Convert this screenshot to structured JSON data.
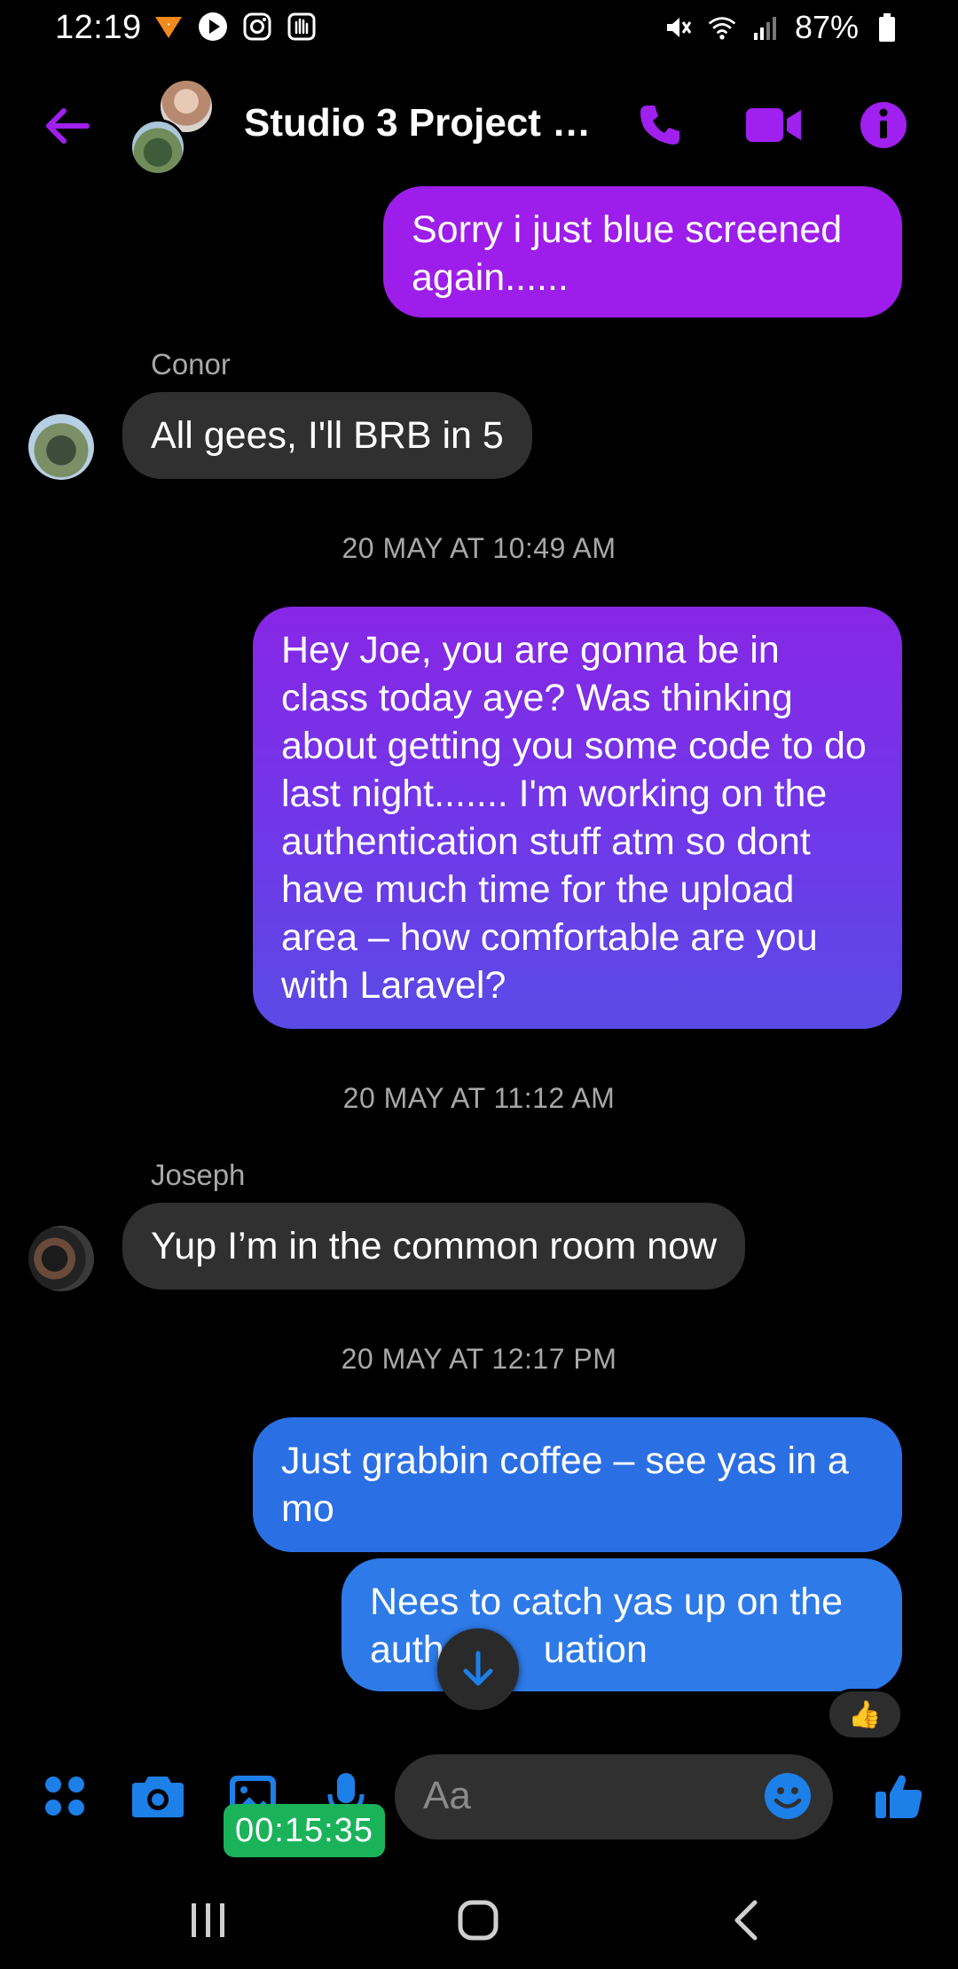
{
  "status_bar": {
    "time": "12:19",
    "battery": "87%",
    "icons": [
      "app-notification-icon",
      "play-icon",
      "instagram-icon",
      "hand-icon",
      "mute-icon",
      "wifi-icon",
      "signal-icon",
      "battery-icon"
    ]
  },
  "header": {
    "title": "Studio 3 Project T...",
    "buttons": [
      "back-arrow-icon",
      "phone-icon",
      "video-icon",
      "info-icon"
    ],
    "accent_color": "#a020f0"
  },
  "messages": [
    {
      "type": "sent",
      "text": "Sorry i just blue screened again......"
    },
    {
      "type": "received",
      "sender": "Conor",
      "text": "All gees, I'll BRB in 5"
    },
    {
      "type": "timestamp",
      "text": "20 MAY AT 10:49 AM"
    },
    {
      "type": "sent",
      "text": "Hey Joe, you are gonna be in class today aye? Was thinking about getting you some code to do last night....... I'm working on the authentication stuff atm so dont have much time for the upload area – how comfortable are you with Laravel?"
    },
    {
      "type": "timestamp",
      "text": "20 MAY AT 11:12 AM"
    },
    {
      "type": "received",
      "sender": "Joseph",
      "text": "Yup I’m in the common room now"
    },
    {
      "type": "timestamp",
      "text": "20 MAY AT 12:17 PM"
    },
    {
      "type": "sent",
      "text": "Just grabbin coffee – see yas in a mo"
    },
    {
      "type": "sent",
      "text": "Nees to catch yas up on the authentication"
    }
  ],
  "last_message_visible": [
    "Nees to catch yas up on the",
    "auth",
    "uation"
  ],
  "reaction": "👍",
  "composer": {
    "placeholder": "Aa",
    "recording_timer": "00:15:35",
    "buttons": [
      "apps-icon",
      "camera-icon",
      "gallery-icon",
      "microphone-icon",
      "emoji-icon",
      "thumbs-up-icon"
    ],
    "accent_color": "#1d7fe8"
  },
  "nav_bar": {
    "buttons": [
      "recents-icon",
      "home-icon",
      "back-icon"
    ]
  }
}
